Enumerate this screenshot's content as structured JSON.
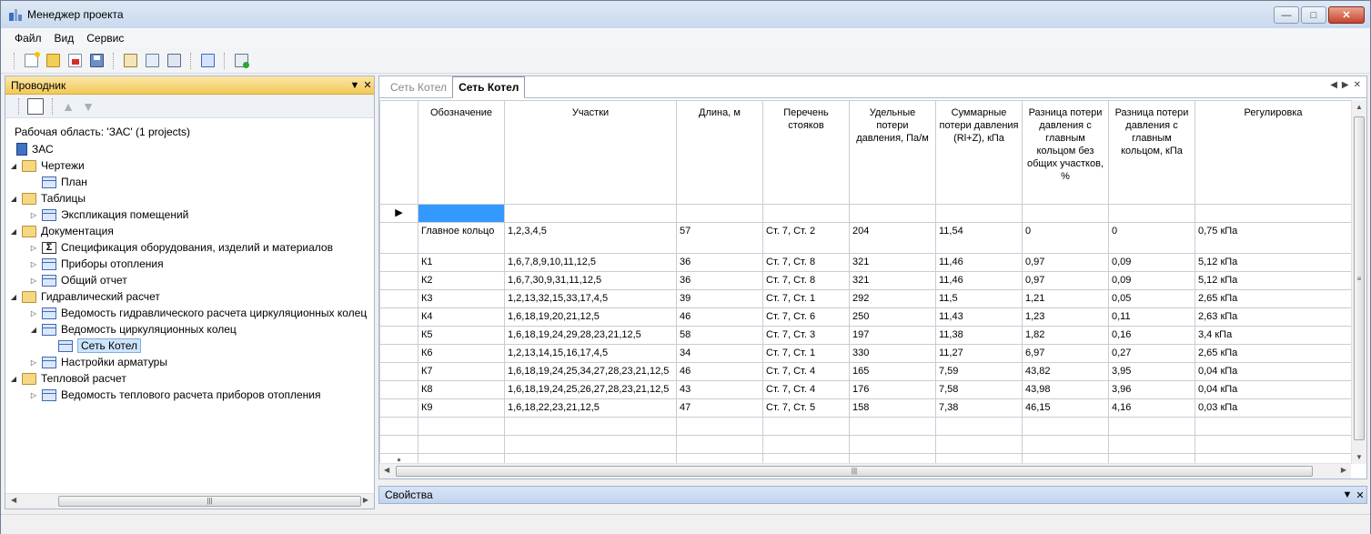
{
  "window": {
    "title": "Менеджер проекта"
  },
  "menu": [
    "Файл",
    "Вид",
    "Сервис"
  ],
  "explorer": {
    "title": "Проводник",
    "workspace": "Рабочая область: 'ЗАС' (1 projects)",
    "tree": [
      {
        "label": "ЗАС",
        "level": 0,
        "icon": "project",
        "exp": ""
      },
      {
        "label": "Чертежи",
        "level": 1,
        "icon": "folder",
        "exp": "open"
      },
      {
        "label": "План",
        "level": 2,
        "icon": "table",
        "exp": ""
      },
      {
        "label": "Таблицы",
        "level": 1,
        "icon": "folder",
        "exp": "open"
      },
      {
        "label": "Экспликация помещений",
        "level": 2,
        "icon": "table",
        "exp": "closed"
      },
      {
        "label": "Документация",
        "level": 1,
        "icon": "folder",
        "exp": "open"
      },
      {
        "label": "Спецификация оборудования, изделий и материалов",
        "level": 2,
        "icon": "sigma",
        "exp": "closed"
      },
      {
        "label": "Приборы отопления",
        "level": 2,
        "icon": "table",
        "exp": "closed"
      },
      {
        "label": "Общий отчет",
        "level": 2,
        "icon": "table",
        "exp": "closed"
      },
      {
        "label": "Гидравлический расчет",
        "level": 1,
        "icon": "folder",
        "exp": "open"
      },
      {
        "label": "Ведомость гидравлического расчета циркуляционных колец",
        "level": 2,
        "icon": "table",
        "exp": "closed"
      },
      {
        "label": "Ведомость циркуляционных колец",
        "level": 2,
        "icon": "table",
        "exp": "open"
      },
      {
        "label": "Сеть Котел",
        "level": 3,
        "icon": "table",
        "exp": "",
        "selected": true
      },
      {
        "label": "Настройки арматуры",
        "level": 2,
        "icon": "table",
        "exp": "closed"
      },
      {
        "label": "Тепловой расчет",
        "level": 1,
        "icon": "folder",
        "exp": "open"
      },
      {
        "label": "Ведомость теплового расчета приборов отопления",
        "level": 2,
        "icon": "table",
        "exp": "closed"
      }
    ]
  },
  "tabs": [
    {
      "label": "Сеть Котел",
      "active": false
    },
    {
      "label": "Сеть Котел",
      "active": true
    }
  ],
  "grid": {
    "columns": [
      "Обозначение",
      "Участки",
      "Длина, м",
      "Перечень стояков",
      "Удельные потери давления, Па/м",
      "Суммарные потери давления (Rl+Z), кПа",
      "Разница потери давления с главным кольцом без общих участков, %",
      "Разница потери давления с главным кольцом, кПа",
      "Регулировка"
    ],
    "rows": [
      [
        "Главное кольцо",
        "1,2,3,4,5",
        "57",
        "Ст. 7, Ст. 2",
        "204",
        "11,54",
        "0",
        "0",
        "0,75 кПа"
      ],
      [
        "К1",
        "1,6,7,8,9,10,11,12,5",
        "36",
        "Ст. 7, Ст. 8",
        "321",
        "11,46",
        "0,97",
        "0,09",
        "5,12 кПа"
      ],
      [
        "К2",
        "1,6,7,30,9,31,11,12,5",
        "36",
        "Ст. 7, Ст. 8",
        "321",
        "11,46",
        "0,97",
        "0,09",
        "5,12 кПа"
      ],
      [
        "К3",
        "1,2,13,32,15,33,17,4,5",
        "39",
        "Ст. 7, Ст. 1",
        "292",
        "11,5",
        "1,21",
        "0,05",
        "2,65 кПа"
      ],
      [
        "К4",
        "1,6,18,19,20,21,12,5",
        "46",
        "Ст. 7, Ст. 6",
        "250",
        "11,43",
        "1,23",
        "0,11",
        "2,63 кПа"
      ],
      [
        "К5",
        "1,6,18,19,24,29,28,23,21,12,5",
        "58",
        "Ст. 7, Ст. 3",
        "197",
        "11,38",
        "1,82",
        "0,16",
        "3,4 кПа"
      ],
      [
        "К6",
        "1,2,13,14,15,16,17,4,5",
        "34",
        "Ст. 7, Ст. 1",
        "330",
        "11,27",
        "6,97",
        "0,27",
        "2,65 кПа"
      ],
      [
        "К7",
        "1,6,18,19,24,25,34,27,28,23,21,12,5",
        "46",
        "Ст. 7, Ст. 4",
        "165",
        "7,59",
        "43,82",
        "3,95",
        "0,04 кПа"
      ],
      [
        "К8",
        "1,6,18,19,24,25,26,27,28,23,21,12,5",
        "43",
        "Ст. 7, Ст. 4",
        "176",
        "7,58",
        "43,98",
        "3,96",
        "0,04 кПа"
      ],
      [
        "К9",
        "1,6,18,22,23,21,12,5",
        "47",
        "Ст. 7, Ст. 5",
        "158",
        "7,38",
        "46,15",
        "4,16",
        "0,03 кПа"
      ]
    ]
  },
  "properties": {
    "title": "Свойства"
  }
}
